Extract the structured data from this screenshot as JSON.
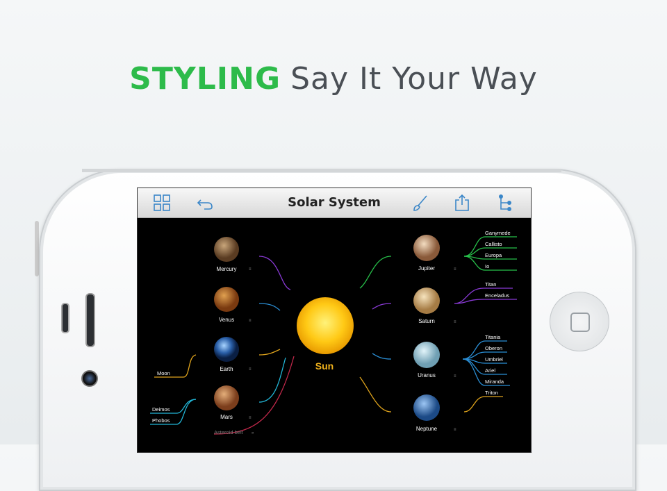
{
  "headline": {
    "keyword": "STYLING",
    "tagline": "Say It Your Way"
  },
  "colors": {
    "accent": "#2dbb4a",
    "purple": "#8a3ad6",
    "blue": "#2b8fd6",
    "orange": "#e0a41c",
    "cyan": "#22b7d8",
    "green": "#27c04a",
    "red": "#c0284a"
  },
  "toolbar": {
    "title": "Solar System",
    "icons": [
      "grid-icon",
      "undo-icon",
      "brush-icon",
      "share-icon",
      "tree-icon"
    ]
  },
  "map": {
    "center": "Sun",
    "left": [
      {
        "name": "Mercury"
      },
      {
        "name": "Venus"
      },
      {
        "name": "Earth"
      },
      {
        "name": "Mars"
      }
    ],
    "right": [
      {
        "name": "Jupiter"
      },
      {
        "name": "Saturn"
      },
      {
        "name": "Uranus"
      },
      {
        "name": "Neptune"
      }
    ],
    "earth_moons": [
      "Moon"
    ],
    "mars_moons": [
      "Deimos",
      "Phobos"
    ],
    "jupiter_moons": [
      "Ganymede",
      "Callisto",
      "Europa",
      "Io"
    ],
    "saturn_moons": [
      "Titan",
      "Enceladus"
    ],
    "uranus_moons": [
      "Titania",
      "Oberon",
      "Umbriel",
      "Ariel",
      "Miranda"
    ],
    "neptune_moons": [
      "Triton"
    ],
    "extra": "Asteroid belt"
  }
}
